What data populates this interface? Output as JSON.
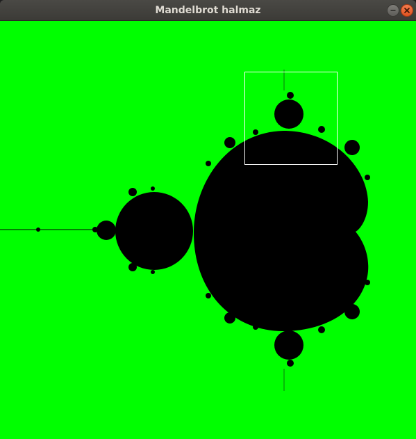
{
  "window": {
    "title": "Mandelbrot halmaz"
  },
  "controls": {
    "minimize_icon": "minimize-icon",
    "close_icon": "close-icon"
  },
  "canvas": {
    "background_color": "#00ff00",
    "set_color": "#000000",
    "selection_color": "#ffffff"
  }
}
